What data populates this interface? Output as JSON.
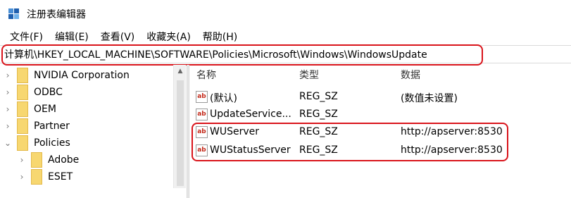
{
  "window": {
    "title": "注册表编辑器",
    "icon": "registry-editor-icon"
  },
  "menu": [
    "文件(F)",
    "编辑(E)",
    "查看(V)",
    "收藏夹(A)",
    "帮助(H)"
  ],
  "address": {
    "path": "计算机\\HKEY_LOCAL_MACHINE\\SOFTWARE\\Policies\\Microsoft\\Windows\\WindowsUpdate"
  },
  "tree": {
    "items": [
      {
        "label": "NVIDIA Corporation",
        "state": "collapsed"
      },
      {
        "label": "ODBC",
        "state": "collapsed"
      },
      {
        "label": "OEM",
        "state": "collapsed"
      },
      {
        "label": "Partner",
        "state": "collapsed"
      },
      {
        "label": "Policies",
        "state": "expanded"
      },
      {
        "label": "Adobe",
        "state": "collapsed"
      },
      {
        "label": "ESET",
        "state": "collapsed"
      }
    ]
  },
  "list": {
    "columns": {
      "name": "名称",
      "type": "类型",
      "data": "数据"
    },
    "rows": [
      {
        "name": "(默认)",
        "type": "REG_SZ",
        "data": "(数值未设置)",
        "icon": "string-value-icon"
      },
      {
        "name": "UpdateService...",
        "type": "REG_SZ",
        "data": "",
        "icon": "string-value-icon"
      },
      {
        "name": "WUServer",
        "type": "REG_SZ",
        "data": "http://apserver:8530",
        "icon": "string-value-icon"
      },
      {
        "name": "WUStatusServer",
        "type": "REG_SZ",
        "data": "http://apserver:8530",
        "icon": "string-value-icon"
      }
    ]
  },
  "colors": {
    "highlight_box": "#d9141b",
    "folder": "#f7d770"
  }
}
